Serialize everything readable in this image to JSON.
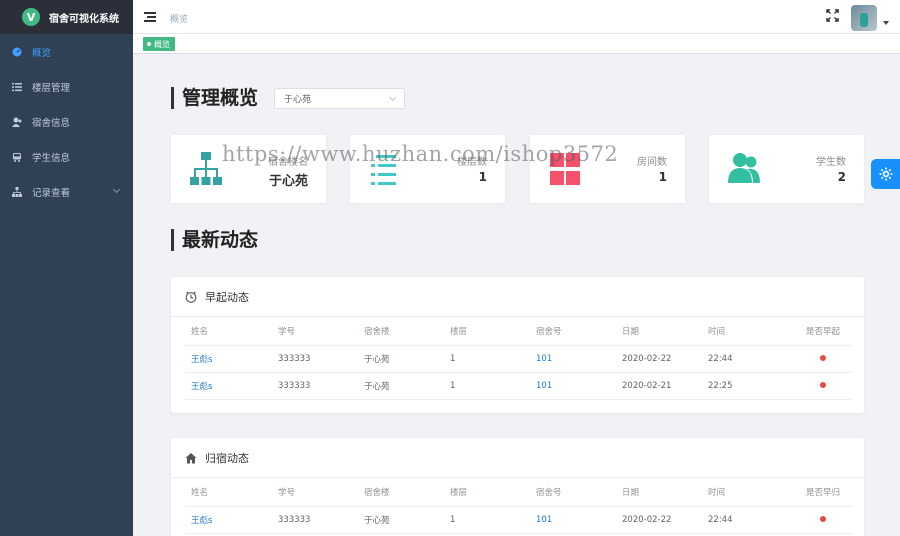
{
  "app": {
    "title": "宿舍可视化系统",
    "logo_letter": "V"
  },
  "sidebar": {
    "items": [
      {
        "label": "概览",
        "icon": "dashboard-icon",
        "active": true
      },
      {
        "label": "楼层管理",
        "icon": "list-icon"
      },
      {
        "label": "宿舍信息",
        "icon": "user-icon"
      },
      {
        "label": "学生信息",
        "icon": "bus-icon"
      },
      {
        "label": "记录查看",
        "icon": "tree-icon",
        "expandable": true
      }
    ]
  },
  "header": {
    "breadcrumb": "概览"
  },
  "tags": [
    {
      "label": "概览",
      "active": true
    }
  ],
  "overview": {
    "title": "管理概览",
    "select_value": "于心苑",
    "cards": [
      {
        "label": "宿舍楼名",
        "value": "于心苑",
        "icon": "sitemap-icon",
        "color": "#36a3a3"
      },
      {
        "label": "楼层数",
        "value": "1",
        "icon": "floor-list-icon",
        "color": "#40c9c6"
      },
      {
        "label": "房间数",
        "value": "1",
        "icon": "grid-icon",
        "color": "#f4516c"
      },
      {
        "label": "学生数",
        "value": "2",
        "icon": "people-icon",
        "color": "#34bfa3"
      }
    ]
  },
  "news": {
    "title": "最新动态"
  },
  "wake_panel": {
    "title": "早起动态",
    "icon": "clock-icon",
    "columns": [
      "姓名",
      "学号",
      "宿舍楼",
      "楼层",
      "宿舍号",
      "日期",
      "时间",
      "是否早起"
    ],
    "rows": [
      [
        "王彪s",
        "333333",
        "于心苑",
        "1",
        "101",
        "2020-02-22",
        "22:44"
      ],
      [
        "王彪s",
        "333333",
        "于心苑",
        "1",
        "101",
        "2020-02-21",
        "22:25"
      ]
    ]
  },
  "return_panel": {
    "title": "归宿动态",
    "icon": "home-icon",
    "columns": [
      "姓名",
      "学号",
      "宿舍楼",
      "楼层",
      "宿舍号",
      "日期",
      "时间",
      "是否早归"
    ],
    "rows": [
      [
        "王彪s",
        "333333",
        "于心苑",
        "1",
        "101",
        "2020-02-22",
        "22:44"
      ]
    ]
  },
  "watermark": "https://www.huzhan.com/ishop3572",
  "colors": {
    "sidebar_bg": "#304156",
    "accent": "#409eff",
    "tag_green": "#42b983",
    "status_red": "#e54d42"
  }
}
